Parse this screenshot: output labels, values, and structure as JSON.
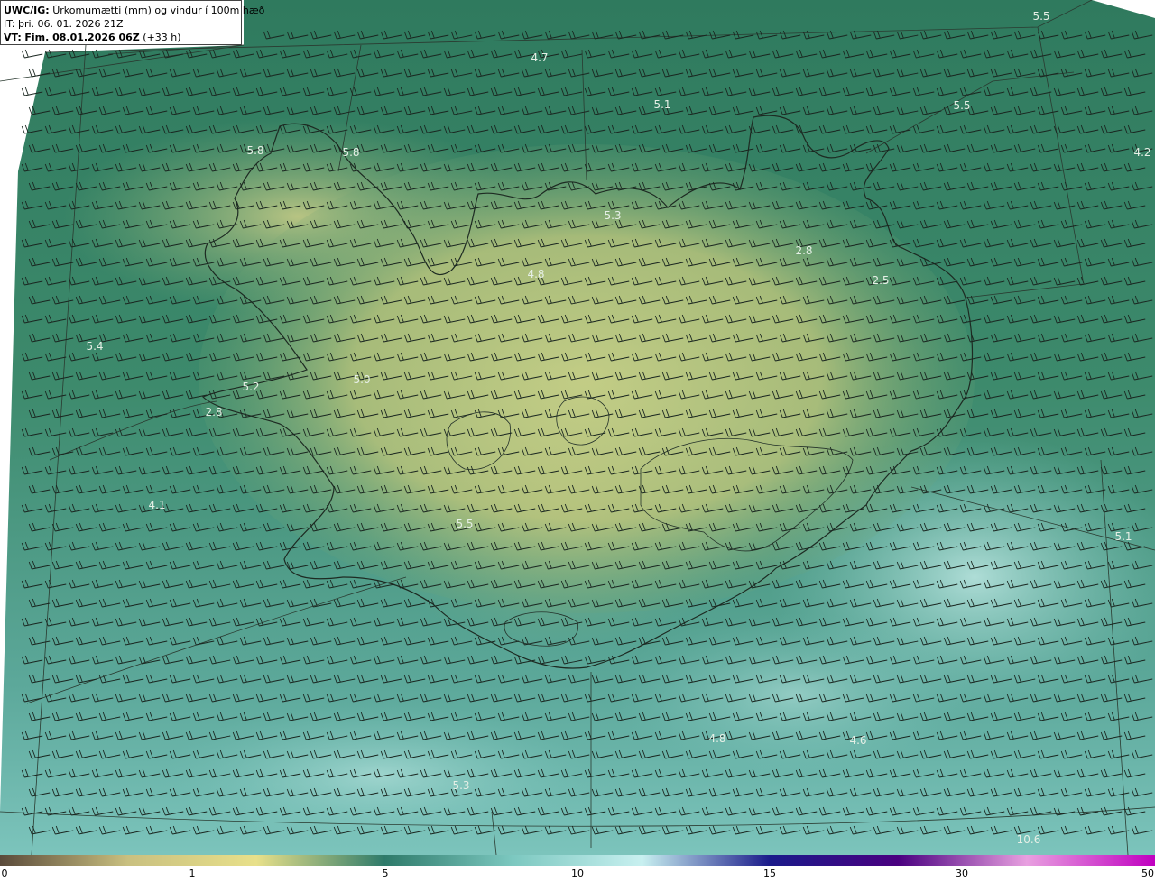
{
  "header": {
    "model_label": "UWC/IG:",
    "title": "Úrkomumætti (mm) og vindur í 100m hæð",
    "initial_time": "IT: þri. 06. 01. 2026 21Z",
    "valid_label": "VT:",
    "valid_time": "Fim. 08.01.2026 06Z",
    "lead_time": "(+33 h)"
  },
  "map_values": [
    "5.5",
    "4.7",
    "5.1",
    "5.5",
    "4.2",
    "5.8",
    "5.8",
    "5.3",
    "2.8",
    "2.5",
    "4.8",
    "5.4",
    "5.0",
    "5.2",
    "2.8",
    "4.1",
    "5.5",
    "5.1",
    "4.8",
    "4.6",
    "5.3",
    "10.6"
  ],
  "colorbar": {
    "ticks": [
      "0",
      "1",
      "5",
      "10",
      "15",
      "30",
      "50"
    ],
    "colors": [
      "#5a4a3a",
      "#c9c080",
      "#e8e08a",
      "#2e7a6a",
      "#7cc8c0",
      "#c8f0f0",
      "#1a1a8a",
      "#4a0080",
      "#e8a0e0",
      "#c000c0"
    ]
  }
}
